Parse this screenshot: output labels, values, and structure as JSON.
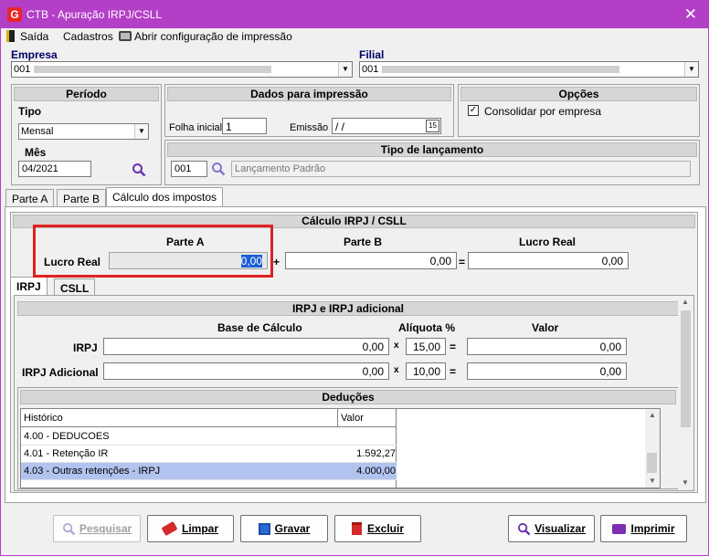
{
  "window": {
    "title": "CTB - Apuração IRPJ/CSLL",
    "app_icon": "G"
  },
  "menu": {
    "exit": "Saída",
    "registers": "Cadastros",
    "print_config": "Abrir configuração de impressão"
  },
  "empresa": {
    "label": "Empresa",
    "value": "001"
  },
  "filial": {
    "label": "Filial",
    "value": "001"
  },
  "periodo": {
    "title": "Período",
    "tipo_label": "Tipo",
    "tipo_value": "Mensal",
    "mes_label": "Mês",
    "mes_value": "04/2021"
  },
  "dados_impressao": {
    "title": "Dados para impressão",
    "folha_label": "Folha inicial",
    "folha_value": "1",
    "emissao_label": "Emissão",
    "emissao_value": " / /",
    "calendar_day": "15"
  },
  "opcoes": {
    "title": "Opções",
    "consolidar_label": "Consolidar por empresa",
    "consolidar_checked": true
  },
  "tipo_lancamento": {
    "title": "Tipo de lançamento",
    "code": "001",
    "description": "Lançamento Padrão"
  },
  "tabs": [
    "Parte A",
    "Parte B",
    "Cálculo dos impostos"
  ],
  "calculo": {
    "title": "Cálculo IRPJ / CSLL",
    "parte_a_label": "Parte A",
    "parte_b_label": "Parte B",
    "lucro_real_col_label": "Lucro Real",
    "lucro_real_row_label": "Lucro Real",
    "parte_a_value": "0,00",
    "parte_b_value": "0,00",
    "lucro_real_value": "0,00",
    "plus": "+",
    "equals": "="
  },
  "subtabs": [
    "IRPJ",
    "CSLL"
  ],
  "irpj": {
    "title": "IRPJ e IRPJ adicional",
    "base_label": "Base de Cálculo",
    "aliquota_label": "Alíquota %",
    "valor_label": "Valor",
    "rows": [
      {
        "label": "IRPJ",
        "base": "0,00",
        "aliquota": "15,00",
        "valor": "0,00"
      },
      {
        "label": "IRPJ Adicional",
        "base": "0,00",
        "aliquota": "10,00",
        "valor": "0,00"
      }
    ],
    "times": "x",
    "equals": "="
  },
  "deducoes": {
    "title": "Deduções",
    "columns": [
      "Histórico",
      "Valor"
    ],
    "rows": [
      {
        "historico": "4.00 - DEDUCOES",
        "valor": ""
      },
      {
        "historico": "4.01 - Retenção IR",
        "valor": "1.592,27"
      },
      {
        "historico": "4.03 - Outras retenções - IRPJ",
        "valor": "4.000,00"
      }
    ]
  },
  "buttons": {
    "pesquisar": "Pesquisar",
    "limpar": "Limpar",
    "gravar": "Gravar",
    "excluir": "Excluir",
    "visualizar": "Visualizar",
    "imprimir": "Imprimir"
  },
  "colors": {
    "title_bar": "#b43fc7",
    "highlight_box": "#e02020",
    "selected_row": "#b3c3ef",
    "search_icon": "#6a2fb3"
  }
}
